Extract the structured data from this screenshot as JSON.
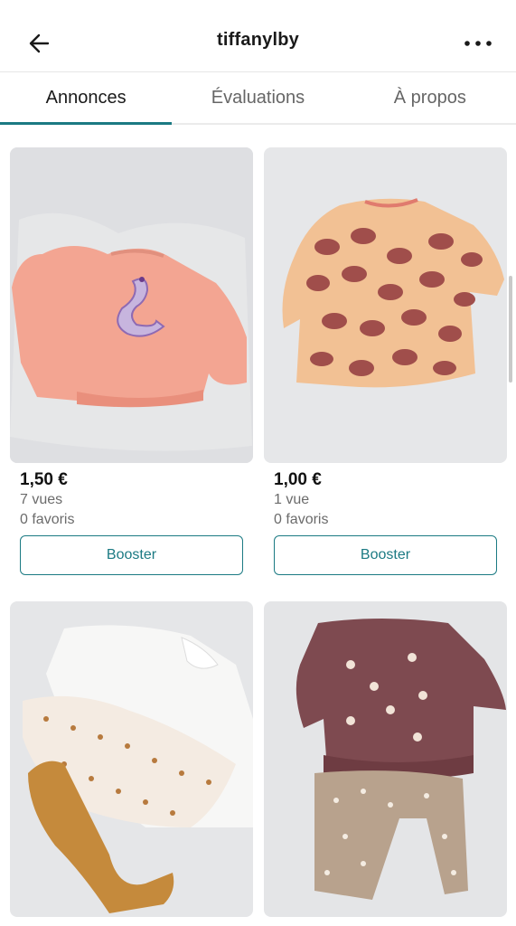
{
  "header": {
    "title": "tiffanylby",
    "back_icon": "arrow-left-icon",
    "more_icon": "more-horizontal-icon"
  },
  "tabs": [
    {
      "label": "Annonces",
      "active": true
    },
    {
      "label": "Évaluations",
      "active": false
    },
    {
      "label": "À propos",
      "active": false
    }
  ],
  "listings": [
    {
      "price": "1,50 €",
      "views": "7 vues",
      "favorites": "0 favoris",
      "button": "Booster"
    },
    {
      "price": "1,00 €",
      "views": "1 vue",
      "favorites": "0 favoris",
      "button": "Booster"
    },
    {},
    {}
  ],
  "colors": {
    "accent": "#1b7a83",
    "muted_text": "#6b6b6b",
    "background": "#ffffff"
  }
}
